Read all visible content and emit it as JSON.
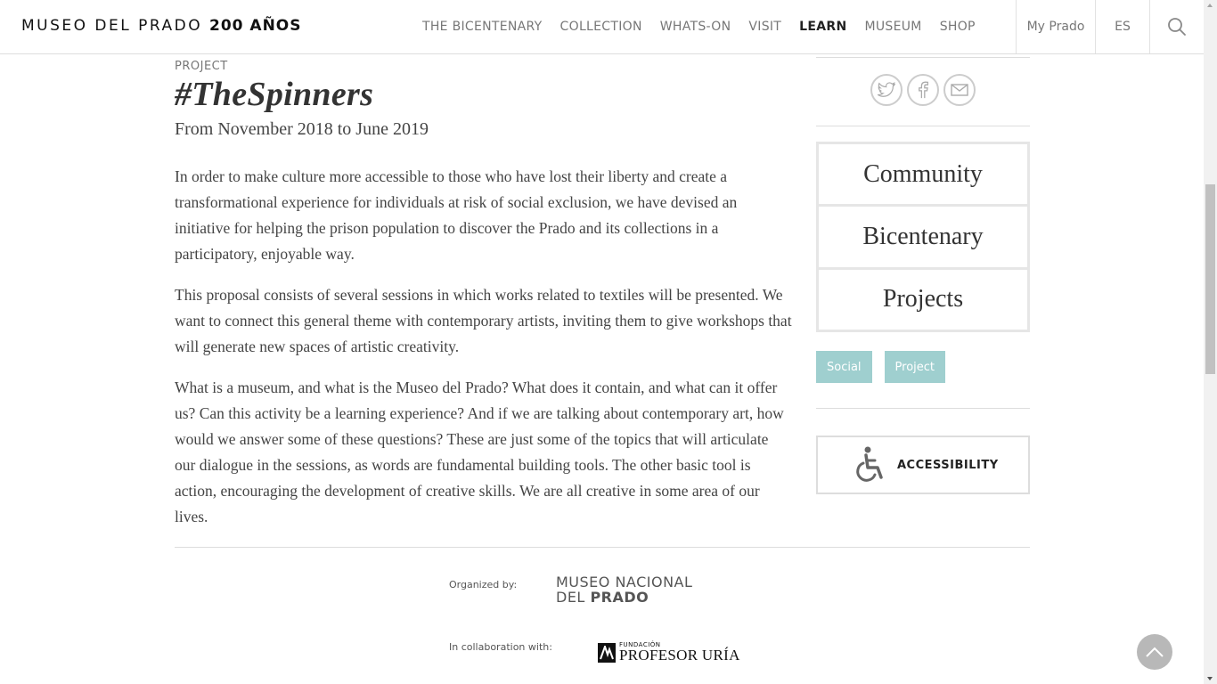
{
  "header": {
    "logo_text": "MUSEO DEL PRADO",
    "logo_bold": "200 AÑOS",
    "nav": [
      {
        "label": "THE BICENTENARY"
      },
      {
        "label": "COLLECTION"
      },
      {
        "label": "WHATS-ON"
      },
      {
        "label": "VISIT"
      },
      {
        "label": "LEARN",
        "active": true
      },
      {
        "label": "MUSEUM"
      },
      {
        "label": "SHOP"
      }
    ],
    "my_prado": "My Prado",
    "language": "ES",
    "search_icon": "search-icon"
  },
  "article": {
    "kicker": "PROJECT",
    "title": "#TheSpinners",
    "dates": "From November 2018 to June 2019",
    "paragraphs": [
      "In order to make culture more accessible to those who have lost their liberty and create a transformational experience for individuals at risk of social exclusion, we have devised an initiative for helping the prison population to discover the Prado and its collections in a participatory, enjoyable way.",
      "This proposal consists of several sessions in which works related to textiles will be presented. We want to connect this general theme with contemporary artists, inviting them to give workshops that will generate new spaces of artistic creativity.",
      "What is a museum, and what is the Museo del Prado? What does it contain, and what can it offer us? Can this activity be a learning experience? And if we are talking about contemporary art, how would we answer some of these questions? These are just some of the topics that will articulate our dialogue in the sessions, as words are fundamental building tools. The other basic tool is action, encouraging the development of creative skills. We are all creative in some area of our lives."
    ]
  },
  "sidebar": {
    "share_icons": [
      "twitter-icon",
      "facebook-icon",
      "email-icon"
    ],
    "categories": [
      "Community",
      "Bicentenary",
      "Projects"
    ],
    "tags": [
      "Social",
      "Project"
    ],
    "accessibility_label": "ACCESSIBILITY",
    "tag_color": "#9fcfcf"
  },
  "credits": {
    "organized_label": "Organized by:",
    "organizer_line1": "MUSEO NACIONAL",
    "organizer_line2_light": "DEL",
    "organizer_line2_bold": "PRADO",
    "collab_label": "In collaboration with:",
    "collab_small": "FUNDACIÓN",
    "collab_big": "PROFESOR URÍA"
  }
}
